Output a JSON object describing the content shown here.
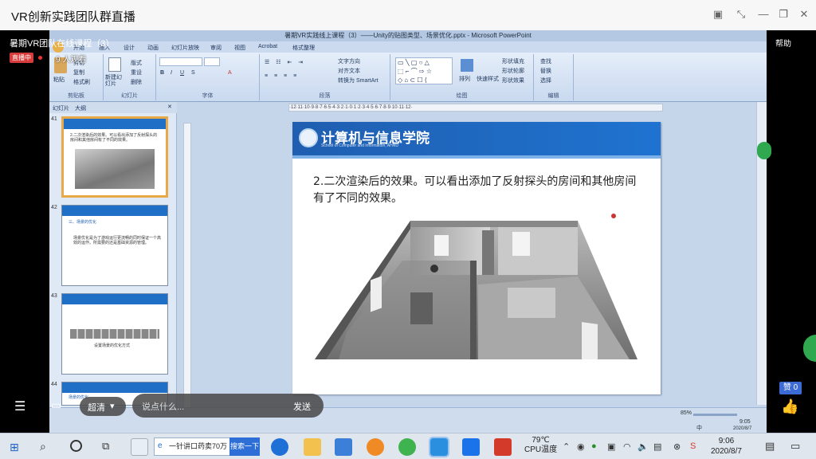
{
  "app": {
    "title": "VR创新实践团队群直播",
    "controls": [
      "restore",
      "shrink",
      "minimize",
      "maximize",
      "close"
    ]
  },
  "live": {
    "room_title": "暑期VR团队在线课程（3）",
    "status": "直播中",
    "viewers": "9 人观看",
    "help": "帮助",
    "likes": "赞 0"
  },
  "ppt": {
    "window_title": "暑期VR实践线上课程（3）——Unity的贴图类型、场景优化.pptx - Microsoft PowerPoint",
    "tabs": [
      "开始",
      "插入",
      "设计",
      "动画",
      "幻灯片放映",
      "审阅",
      "视图",
      "Acrobat",
      "格式整理"
    ],
    "groups": [
      "剪贴板",
      "幻灯片",
      "字体",
      "段落",
      "绘图",
      "编辑"
    ],
    "clipboard": {
      "paste": "粘贴",
      "cut": "剪切",
      "copy": "复制",
      "format": "格式刷"
    },
    "slides_grp": {
      "new": "新建幻灯片",
      "layout": "版式",
      "reset": "重设",
      "delete": "删除"
    },
    "paragraph": {
      "direction": "文字方向",
      "align": "对齐文本",
      "smartart": "转换为 SmartArt"
    },
    "drawing": {
      "arrange": "排列",
      "quick": "快速样式",
      "fill": "形状填充",
      "outline": "形状轮廓",
      "effect": "形状效果"
    },
    "editing": {
      "find": "查找",
      "replace": "替换",
      "select": "选择"
    },
    "panel_tabs": [
      "幻灯片",
      "大纲"
    ],
    "thumbs": [
      {
        "num": "41",
        "text": "2.二次渲染后的效果。可以看出添加了反射探头的房间和其他房间有了不同的效果。"
      },
      {
        "num": "42",
        "text": "三、场景的优化",
        "sub": "场景优化是为了游戏运行更流畅的同时保证一个高效的运作。所需要的还是基础资源的管理。"
      },
      {
        "num": "43",
        "text": "",
        "sub": "设置场景的优化方式"
      },
      {
        "num": "44",
        "text": "场景的优化",
        "sub": ""
      }
    ],
    "slide": {
      "school_cn": "计算机与信息学院",
      "school_en": "School of Computer and Information, AHNU",
      "text": "2.二次渲染后的效果。可以看出添加了反射探头的房间和其他房间有了不同的效果。"
    },
    "status": {
      "zoom": "85%",
      "time": "9:05",
      "date": "2020/8/7",
      "ime": "中"
    }
  },
  "controls": {
    "quality": "超清",
    "comment_placeholder": "说点什么...",
    "send": "发送"
  },
  "taskbar": {
    "search_text": "一针讲口药卖70万",
    "search_button": "搜索一下",
    "temperature": "79℃",
    "cpu_label": "CPU温度",
    "time": "9:06",
    "date": "2020/8/7"
  }
}
